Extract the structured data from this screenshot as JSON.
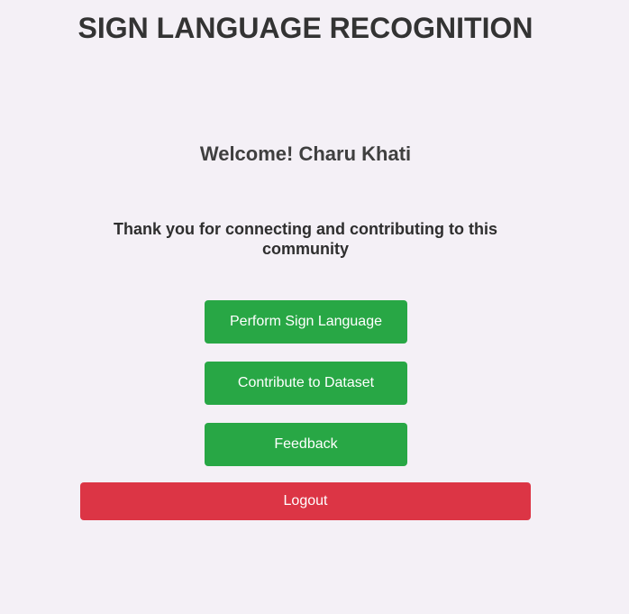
{
  "header": {
    "title": "SIGN LANGUAGE RECOGNITION"
  },
  "main": {
    "welcome": "Welcome! Charu Khati",
    "message": "Thank you for connecting and contributing to this community",
    "buttons": {
      "perform": "Perform Sign Language",
      "contribute": "Contribute to Dataset",
      "feedback": "Feedback",
      "logout": "Logout"
    }
  },
  "colors": {
    "primary": "#28a745",
    "danger": "#dc3545",
    "background": "#f4f0f6"
  }
}
